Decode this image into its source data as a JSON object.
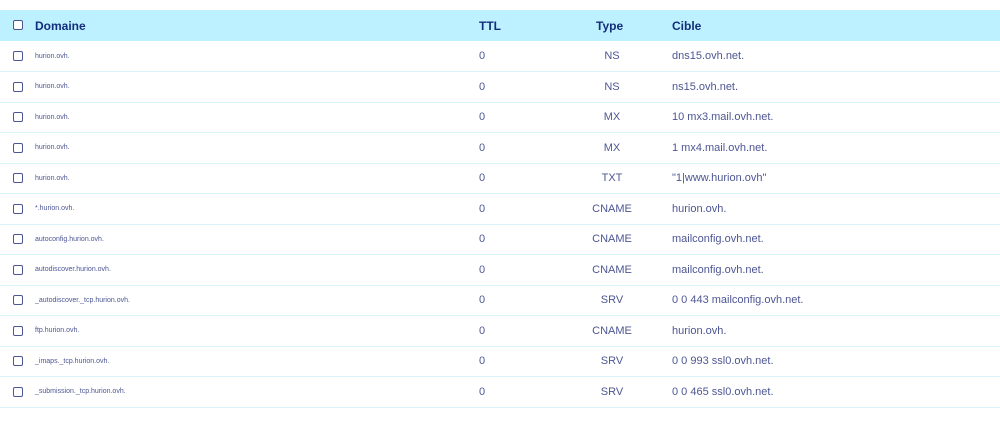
{
  "table": {
    "headers": {
      "domain": "Domaine",
      "ttl": "TTL",
      "type": "Type",
      "cible": "Cible"
    },
    "rows": [
      {
        "domain": "hurion.ovh.",
        "ttl": "0",
        "type": "NS",
        "cible": "dns15.ovh.net."
      },
      {
        "domain": "hurion.ovh.",
        "ttl": "0",
        "type": "NS",
        "cible": "ns15.ovh.net."
      },
      {
        "domain": "hurion.ovh.",
        "ttl": "0",
        "type": "MX",
        "cible": "10 mx3.mail.ovh.net."
      },
      {
        "domain": "hurion.ovh.",
        "ttl": "0",
        "type": "MX",
        "cible": "1 mx4.mail.ovh.net."
      },
      {
        "domain": "hurion.ovh.",
        "ttl": "0",
        "type": "TXT",
        "cible": "\"1|www.hurion.ovh\""
      },
      {
        "domain": "*.hurion.ovh.",
        "ttl": "0",
        "type": "CNAME",
        "cible": "hurion.ovh."
      },
      {
        "domain": "autoconfig.hurion.ovh.",
        "ttl": "0",
        "type": "CNAME",
        "cible": "mailconfig.ovh.net."
      },
      {
        "domain": "autodiscover.hurion.ovh.",
        "ttl": "0",
        "type": "CNAME",
        "cible": "mailconfig.ovh.net."
      },
      {
        "domain": "_autodiscover._tcp.hurion.ovh.",
        "ttl": "0",
        "type": "SRV",
        "cible": "0 0 443 mailconfig.ovh.net."
      },
      {
        "domain": "ftp.hurion.ovh.",
        "ttl": "0",
        "type": "CNAME",
        "cible": "hurion.ovh."
      },
      {
        "domain": "_imaps._tcp.hurion.ovh.",
        "ttl": "0",
        "type": "SRV",
        "cible": "0 0 993 ssl0.ovh.net."
      },
      {
        "domain": "_submission._tcp.hurion.ovh.",
        "ttl": "0",
        "type": "SRV",
        "cible": "0 0 465 ssl0.ovh.net."
      }
    ]
  },
  "colors": {
    "header_bg": "#bef1ff",
    "header_text": "#122e7c",
    "row_text": "#4d5693",
    "row_border": "#d9f4fb"
  }
}
